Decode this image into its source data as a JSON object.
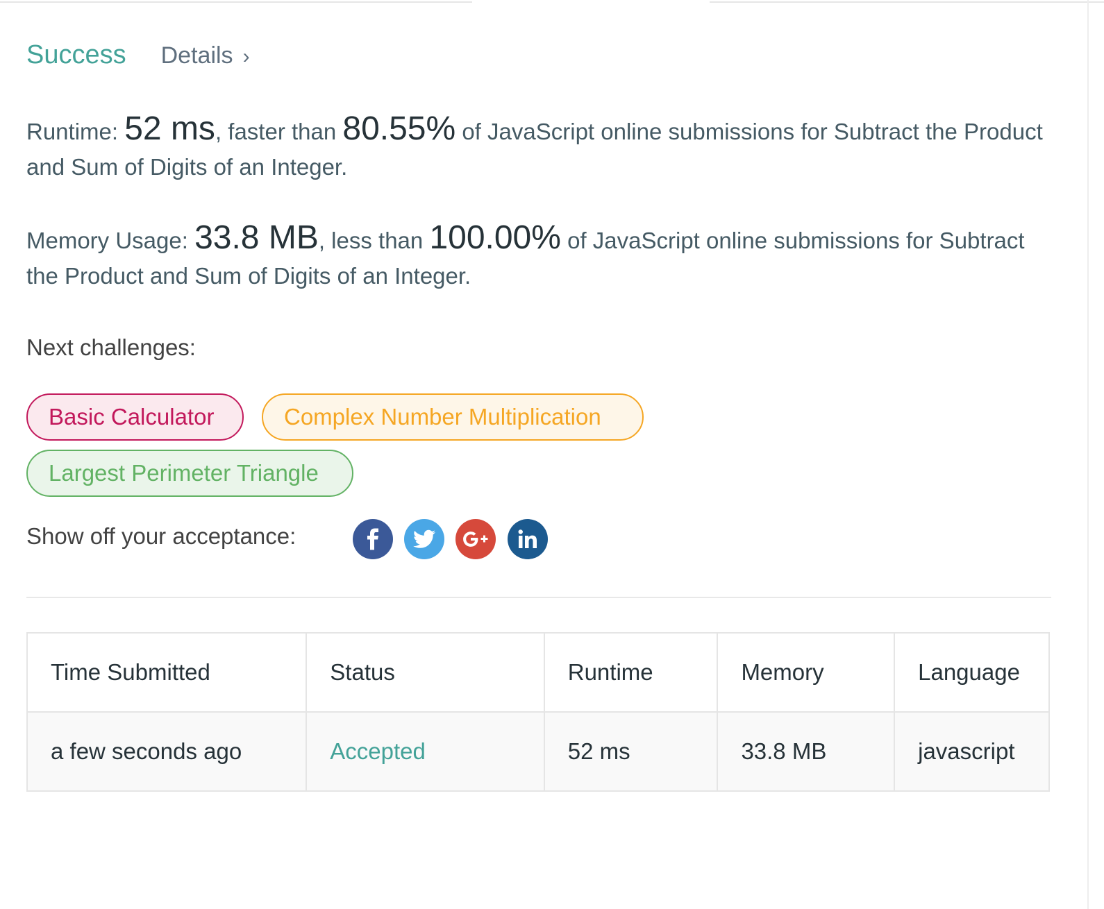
{
  "result": {
    "status": "Success",
    "details_label": "Details",
    "details_chevron": "›"
  },
  "runtime_stat": {
    "label": "Runtime: ",
    "value": "52 ms",
    "comparison": ", faster than ",
    "percent": "80.55%",
    "suffix": " of JavaScript online submissions for Subtract the Product and Sum of Digits of an Integer."
  },
  "memory_stat": {
    "label": "Memory Usage: ",
    "value": "33.8 MB",
    "comparison": ", less than ",
    "percent": "100.00%",
    "suffix": " of JavaScript online submissions for Subtract the Product and Sum of Digits of an Integer."
  },
  "next_challenges": {
    "label": "Next challenges:",
    "items": [
      {
        "title": "Basic Calculator",
        "difficulty_color": "#c2185b"
      },
      {
        "title": "Complex Number Multiplication",
        "difficulty_color": "#f5a623"
      },
      {
        "title": "Largest Perimeter Triangle",
        "difficulty_color": "#62b264"
      }
    ]
  },
  "share": {
    "label": "Show off your acceptance:",
    "buttons": [
      {
        "icon": "facebook-icon",
        "color": "#3b5998"
      },
      {
        "icon": "twitter-icon",
        "color": "#4aa7e6"
      },
      {
        "icon": "google-plus-icon",
        "color": "#d6493b"
      },
      {
        "icon": "linkedin-icon",
        "color": "#1c5a8f"
      }
    ]
  },
  "submissions": {
    "headers": [
      "Time Submitted",
      "Status",
      "Runtime",
      "Memory",
      "Language"
    ],
    "rows": [
      [
        "a few seconds ago",
        "Accepted",
        "52 ms",
        "33.8 MB",
        "javascript"
      ]
    ],
    "accepted_color": "#43a298"
  }
}
